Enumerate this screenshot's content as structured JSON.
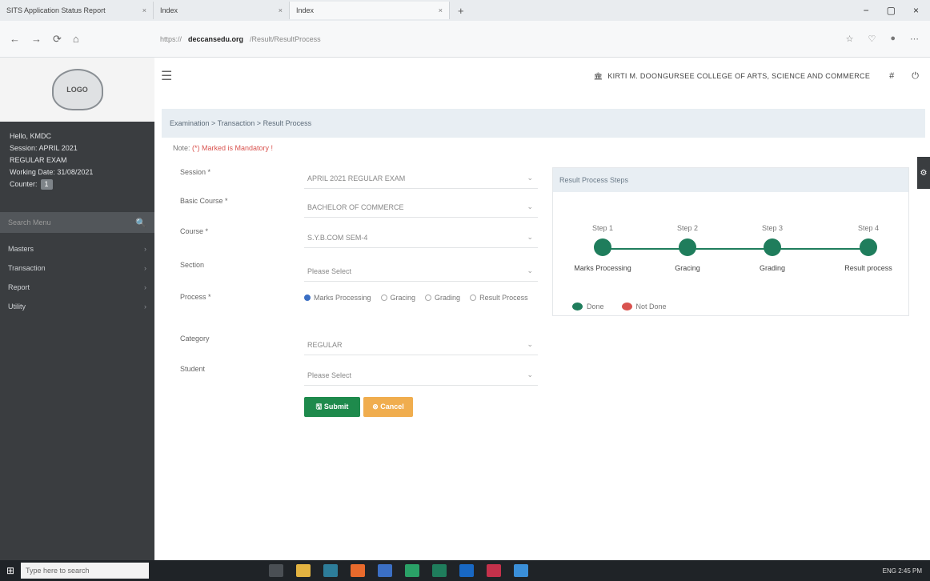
{
  "browser": {
    "tabs": [
      {
        "label": "SITS Application Status Report",
        "close": "×"
      },
      {
        "label": "Index",
        "close": "×"
      },
      {
        "label": "Index",
        "close": "×"
      }
    ],
    "new_tab": "+",
    "window_controls": [
      "−",
      "▢",
      "×"
    ],
    "nav": [
      "←",
      "→",
      "⟳",
      "⌂"
    ],
    "url_prefix": "https://",
    "url_domain": "deccansedu.org",
    "url_path": "/Result/ResultProcess",
    "icons": [
      "☆",
      "♡",
      "●",
      "⋯"
    ]
  },
  "sidebar": {
    "logo_text": "LOGO",
    "user_lines": [
      "Hello, KMDC",
      "Session: APRIL 2021",
      "REGULAR EXAM",
      "Working Date: 31/08/2021"
    ],
    "counter_label": "Counter:",
    "counter_value": "1",
    "search_placeholder": "Search Menu",
    "search_icon": "🔍",
    "menu": [
      {
        "label": "Masters",
        "chev": "›"
      },
      {
        "label": "Transaction",
        "chev": "›"
      },
      {
        "label": "Report",
        "chev": "›"
      },
      {
        "label": "Utility",
        "chev": "›"
      }
    ]
  },
  "header": {
    "menu_icon": "☰",
    "college_icon": "🏛",
    "college_name": "KIRTI M. DOONGURSEE COLLEGE OF ARTS, SCIENCE AND COMMERCE",
    "icons": [
      "#",
      "⏻"
    ]
  },
  "breadcrumb": "Examination > Transaction > Result Process",
  "note": {
    "prefix": "Note: ",
    "text": "(*) Marked is Mandatory !"
  },
  "form": {
    "fields": [
      {
        "label": "Session *",
        "value": "APRIL 2021 REGULAR EXAM",
        "caret": "⌄"
      },
      {
        "label": "Basic Course *",
        "value": "BACHELOR OF COMMERCE",
        "caret": "⌄"
      },
      {
        "label": "Course *",
        "value": "S.Y.B.COM SEM-4",
        "caret": "⌄"
      },
      {
        "label": "Section",
        "value": "Please Select",
        "caret": "⌄"
      }
    ],
    "process_label": "Process *",
    "process_options": [
      {
        "label": "Marks Processing",
        "selected": true
      },
      {
        "label": "Gracing",
        "selected": false
      },
      {
        "label": "Grading",
        "selected": false
      },
      {
        "label": "Result Process",
        "selected": false
      }
    ],
    "fields2": [
      {
        "label": "Category",
        "value": "REGULAR",
        "caret": "⌄"
      },
      {
        "label": "Student",
        "value": "Please Select",
        "caret": "⌄"
      }
    ],
    "submit": "🖫 Submit",
    "cancel": "⊗ Cancel"
  },
  "steps_panel": {
    "title": "Result Process Steps",
    "steps": [
      {
        "num": "Step 1",
        "name": "Marks Processing"
      },
      {
        "num": "Step 2",
        "name": "Gracing"
      },
      {
        "num": "Step 3",
        "name": "Grading"
      },
      {
        "num": "Step 4",
        "name": "Result process"
      }
    ],
    "legend": [
      {
        "label": "Done",
        "color": "#1f7d5c"
      },
      {
        "label": "Not Done",
        "color": "#d9534f"
      }
    ]
  },
  "settings_tab_icon": "⚙",
  "taskbar": {
    "start_icon": "⊞",
    "search_placeholder": "Type here to search",
    "tray_text": "ENG  2:45 PM"
  },
  "colors": {
    "accent": "#1f7d5c",
    "submit": "#1e8a4c",
    "cancel": "#f0ad4e",
    "sidebar": "#3a3d40"
  }
}
